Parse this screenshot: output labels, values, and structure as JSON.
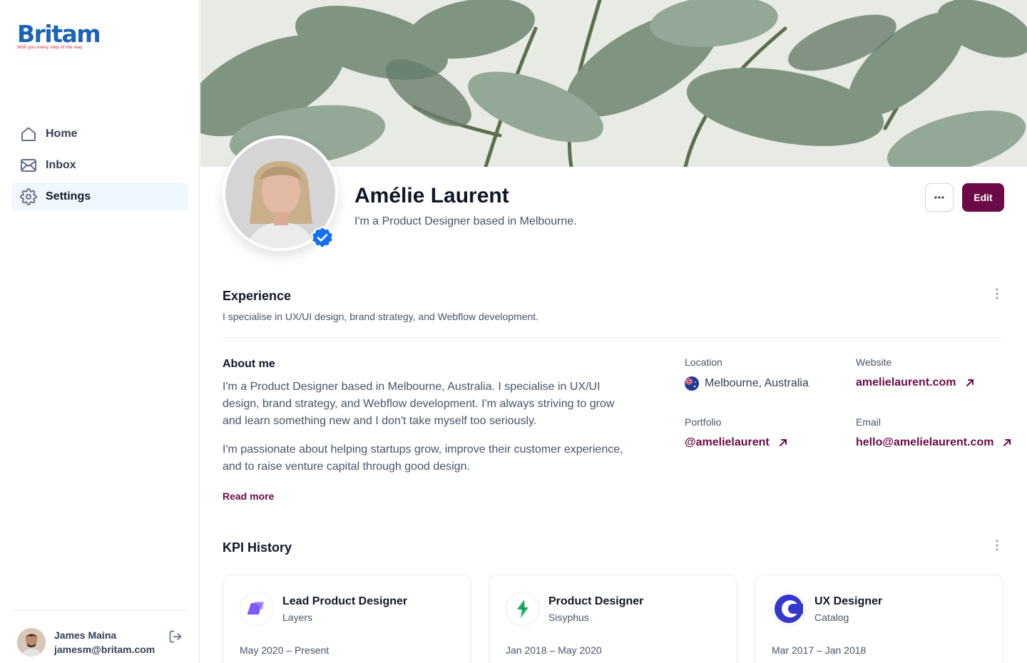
{
  "brand": {
    "name": "Britam",
    "tagline": "With you every step of the way"
  },
  "nav": [
    {
      "label": "Home",
      "icon": "home-icon"
    },
    {
      "label": "Inbox",
      "icon": "mail-icon"
    },
    {
      "label": "Settings",
      "icon": "gear-icon",
      "active": true
    }
  ],
  "user": {
    "name": "James Maina",
    "email": "jamesm@britam.com"
  },
  "profile": {
    "name": "Amélie Laurent",
    "tagline": "I'm a Product Designer based in Melbourne.",
    "verified": true,
    "edit_label": "Edit"
  },
  "experience": {
    "title": "Experience",
    "description": "I specialise in UX/UI design, brand strategy, and Webflow development."
  },
  "about": {
    "title": "About me",
    "paragraphs": [
      "I'm a Product Designer based in Melbourne, Australia. I specialise in UX/UI design, brand strategy, and Webflow development. I'm always striving to grow and learn something new and I don't take myself too seriously.",
      "I'm passionate about helping startups grow, improve their customer experience, and to raise venture capital through good design."
    ],
    "read_more": "Read more"
  },
  "info": {
    "location": {
      "label": "Location",
      "value": "Melbourne, Australia"
    },
    "website": {
      "label": "Website",
      "value": "amelielaurent.com"
    },
    "portfolio": {
      "label": "Portfolio",
      "value": "@amelielaurent"
    },
    "email": {
      "label": "Email",
      "value": "hello@amelielaurent.com"
    }
  },
  "kpi": {
    "title": "KPI History",
    "items": [
      {
        "role": "Lead Product Designer",
        "company": "Layers",
        "dates": "May 2020 – Present"
      },
      {
        "role": "Product Designer",
        "company": "Sisyphus",
        "dates": "Jan 2018 – May 2020"
      },
      {
        "role": "UX Designer",
        "company": "Catalog",
        "dates": "Mar 2017 – Jan 2018"
      }
    ]
  },
  "colors": {
    "accent": "#6b0a47",
    "brand_blue": "#1b63b5",
    "brand_red": "#d1262f",
    "active_nav_bg": "#f0f7fe"
  }
}
